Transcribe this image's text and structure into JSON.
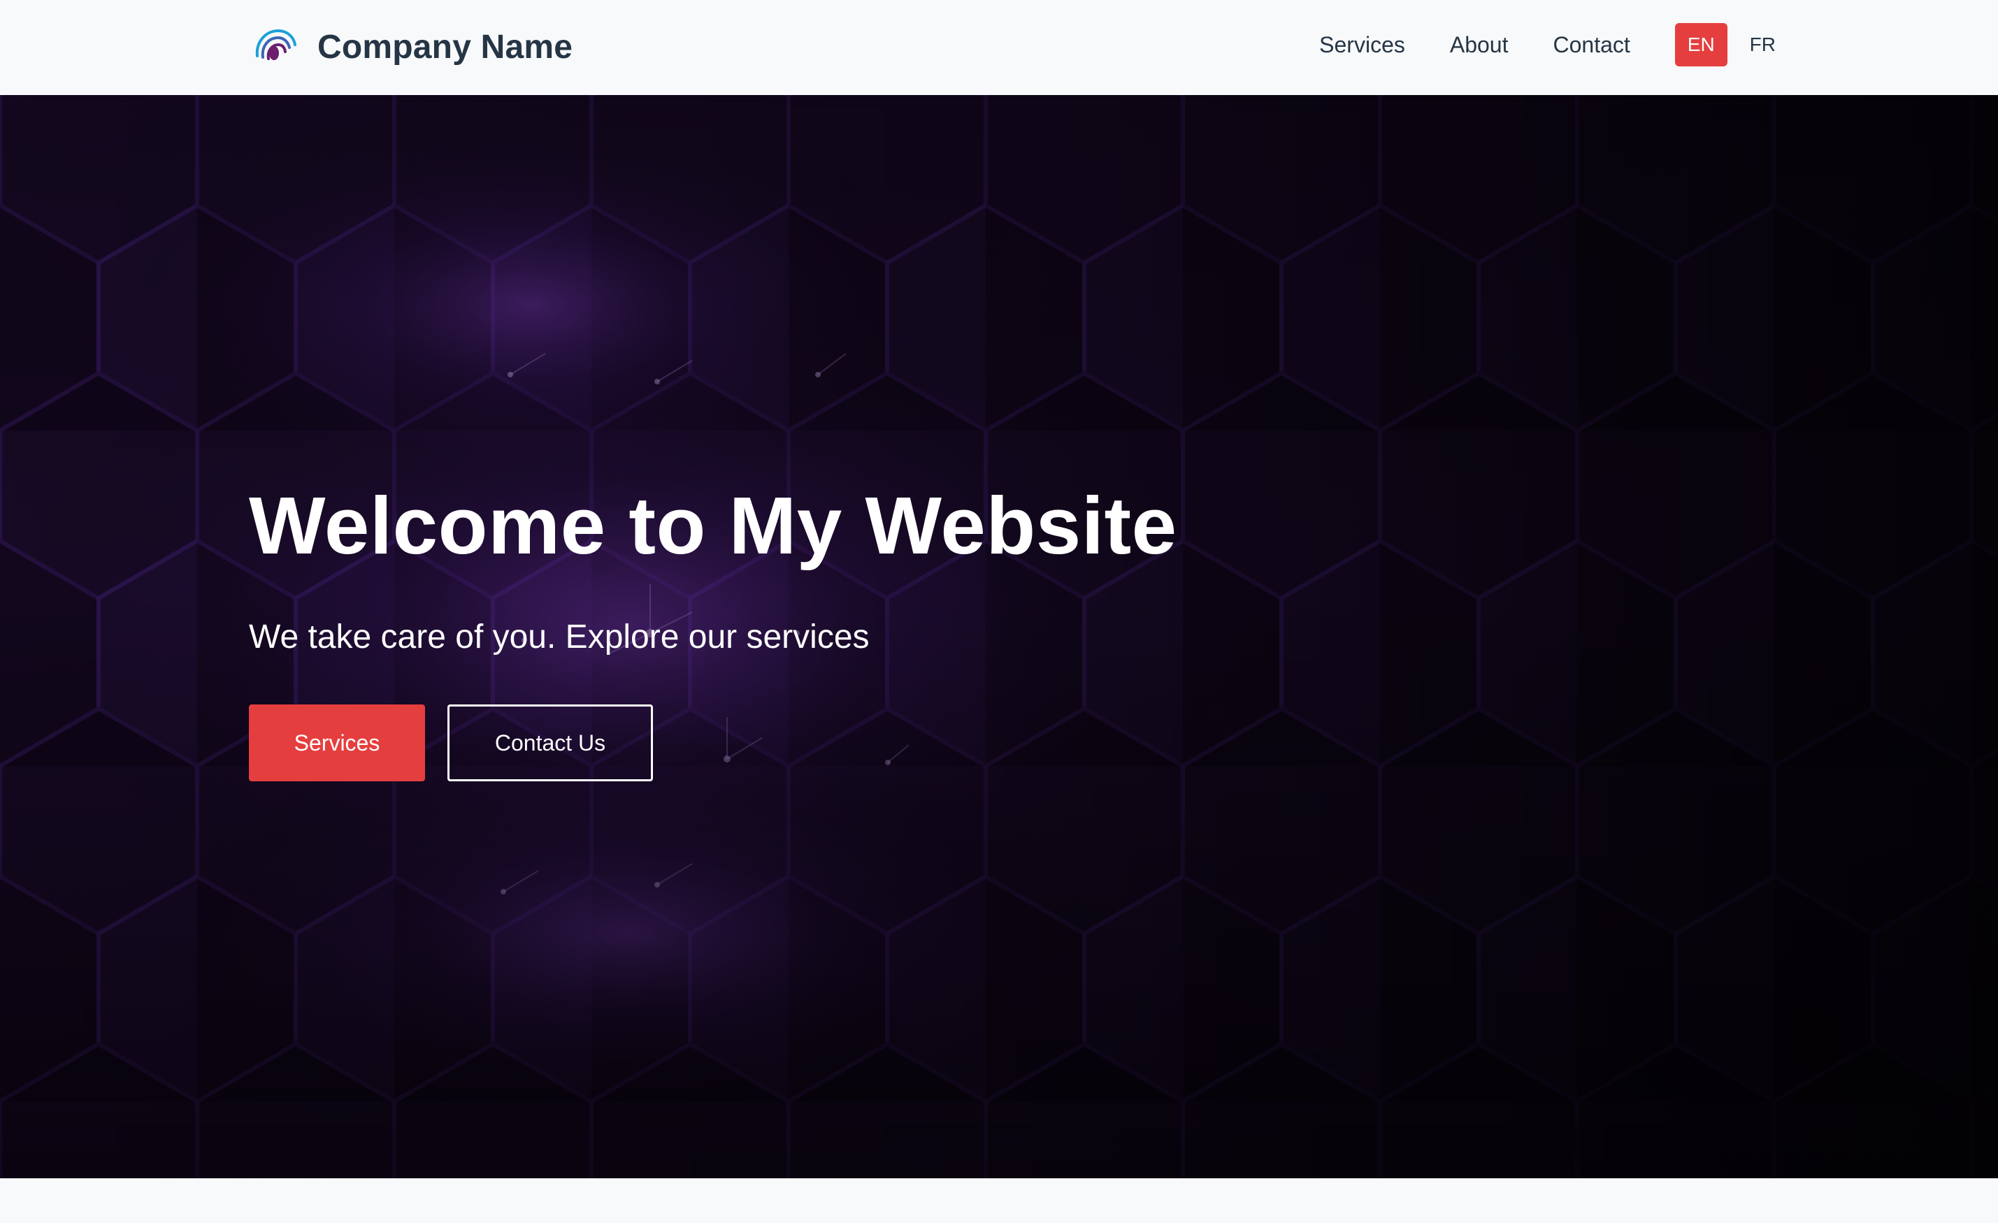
{
  "header": {
    "company_name": "Company Name",
    "logo_icon": "company-logo-icon",
    "nav": [
      {
        "label": "Services"
      },
      {
        "label": "About"
      },
      {
        "label": "Contact"
      }
    ],
    "languages": [
      {
        "label": "EN",
        "active": true
      },
      {
        "label": "FR",
        "active": false
      }
    ]
  },
  "hero": {
    "title": "Welcome to My Website",
    "subtitle": "We take care of you. Explore our services",
    "primary_button": "Services",
    "secondary_button": "Contact Us",
    "background": "dark-purple-hexagon-pattern"
  },
  "colors": {
    "accent": "#e53e3e",
    "header_bg": "#f7f9fa",
    "text_dark": "#263545",
    "hero_bg": "#07040c",
    "hex_glow": "#7a2fc8",
    "logo_blue": "#1aa0d8",
    "logo_purple": "#6b1f6d"
  }
}
